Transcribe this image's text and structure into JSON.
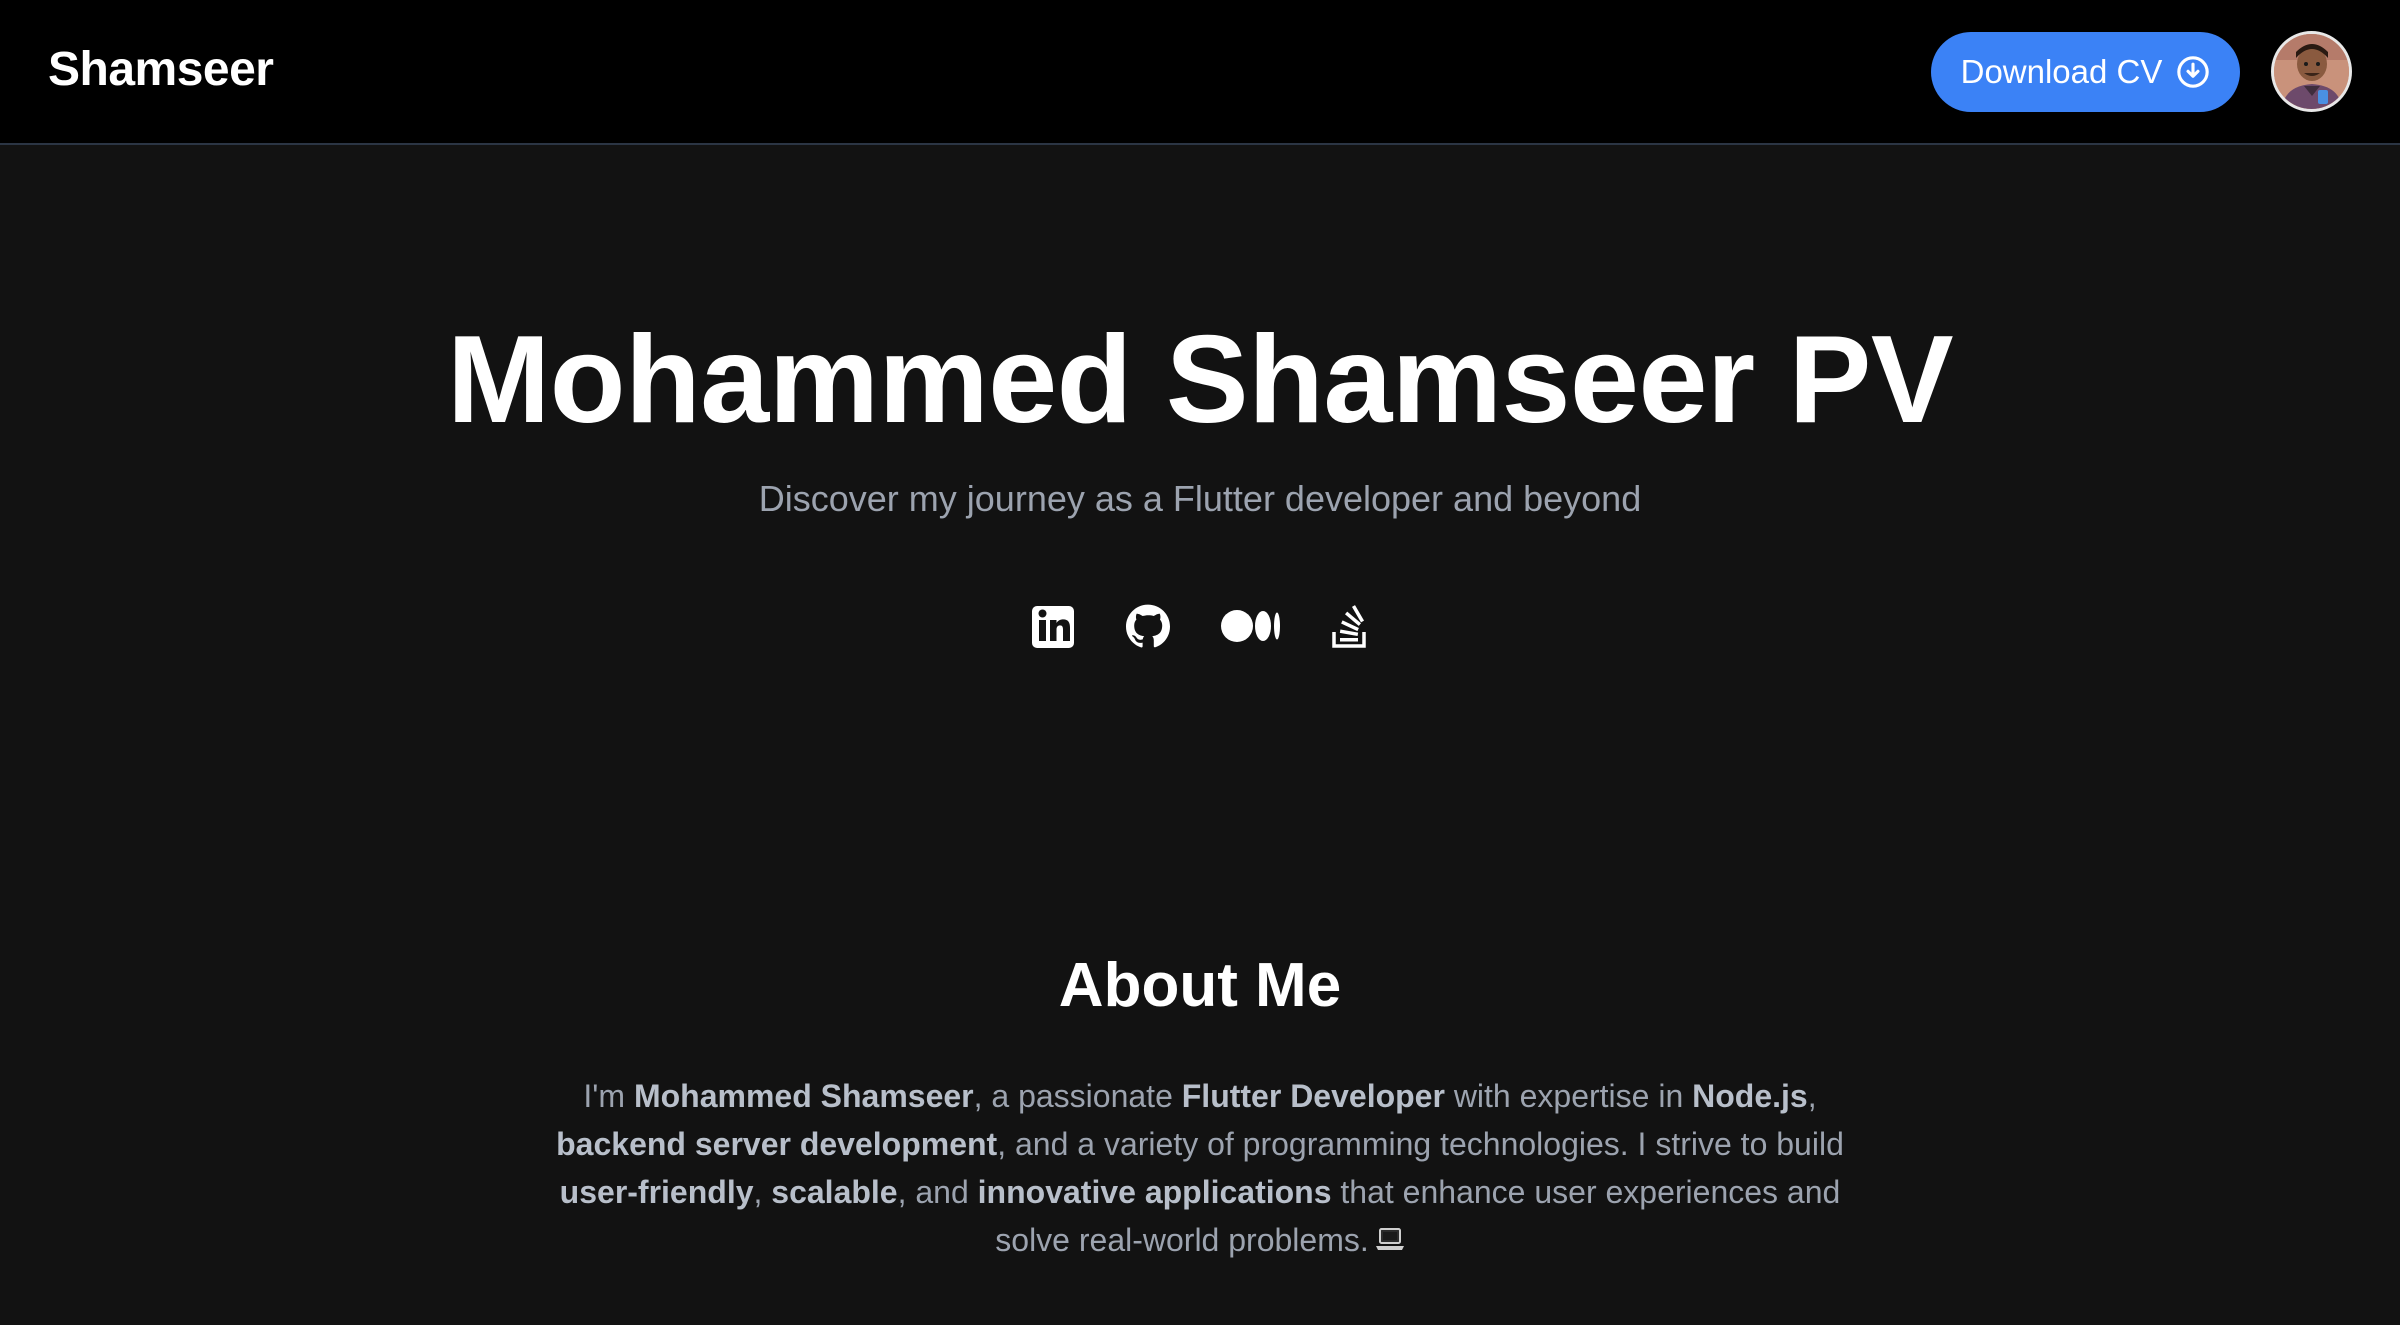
{
  "header": {
    "brand": "Shamseer",
    "download_label": "Download CV",
    "download_icon": "download-circle-icon",
    "avatar_icon": "profile-avatar"
  },
  "hero": {
    "title": "Mohammed Shamseer PV",
    "subtitle": "Discover my journey as a Flutter developer and beyond",
    "socials": [
      {
        "icon": "linkedin-icon"
      },
      {
        "icon": "github-icon"
      },
      {
        "icon": "medium-icon"
      },
      {
        "icon": "stackoverflow-icon"
      }
    ]
  },
  "about": {
    "title": "About Me",
    "segments": {
      "s1": "I'm ",
      "b1": "Mohammed Shamseer",
      "s2": ", a passionate ",
      "b2": "Flutter Developer",
      "s3": " with expertise in ",
      "b3": "Node.js",
      "s4": ", ",
      "b4": "backend server development",
      "s5": ", and a variety of programming technologies. I strive to build ",
      "b5": "user-friendly",
      "s6": ", ",
      "b6": "scalable",
      "s7": ", and ",
      "b7": "innovative applications",
      "s8": " that enhance user experiences and solve real-world problems."
    },
    "trailing_icon": "laptop-icon"
  },
  "colors": {
    "page_bg": "#121212",
    "header_bg": "#000000",
    "accent": "#3b82f6",
    "muted_text": "#9ca3af",
    "divider": "#2b3544"
  }
}
